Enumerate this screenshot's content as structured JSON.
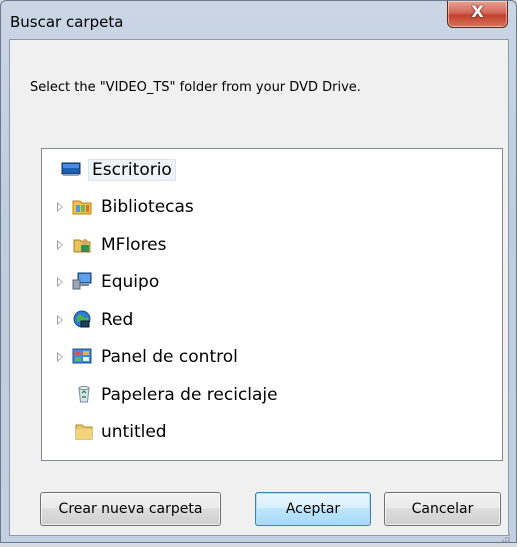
{
  "window": {
    "title": "Buscar carpeta",
    "close_label": "X"
  },
  "instructions": "Select the \"VIDEO_TS\" folder from your DVD Drive.",
  "tree": {
    "items": [
      {
        "label": "Escritorio",
        "icon": "desktop-icon",
        "expandable": false,
        "selected": true
      },
      {
        "label": "Bibliotecas",
        "icon": "libraries-icon",
        "expandable": true
      },
      {
        "label": "MFlores",
        "icon": "user-folder-icon",
        "expandable": true
      },
      {
        "label": "Equipo",
        "icon": "computer-icon",
        "expandable": true
      },
      {
        "label": "Red",
        "icon": "network-icon",
        "expandable": true
      },
      {
        "label": "Panel de control",
        "icon": "control-panel-icon",
        "expandable": true
      },
      {
        "label": "Papelera de reciclaje",
        "icon": "recycle-bin-icon",
        "expandable": false
      },
      {
        "label": "untitled",
        "icon": "folder-icon",
        "expandable": false
      }
    ]
  },
  "buttons": {
    "new_folder": "Crear nueva carpeta",
    "ok": "Aceptar",
    "cancel": "Cancelar"
  },
  "colors": {
    "accent": "#3c7fb1",
    "close": "#c2402c"
  }
}
